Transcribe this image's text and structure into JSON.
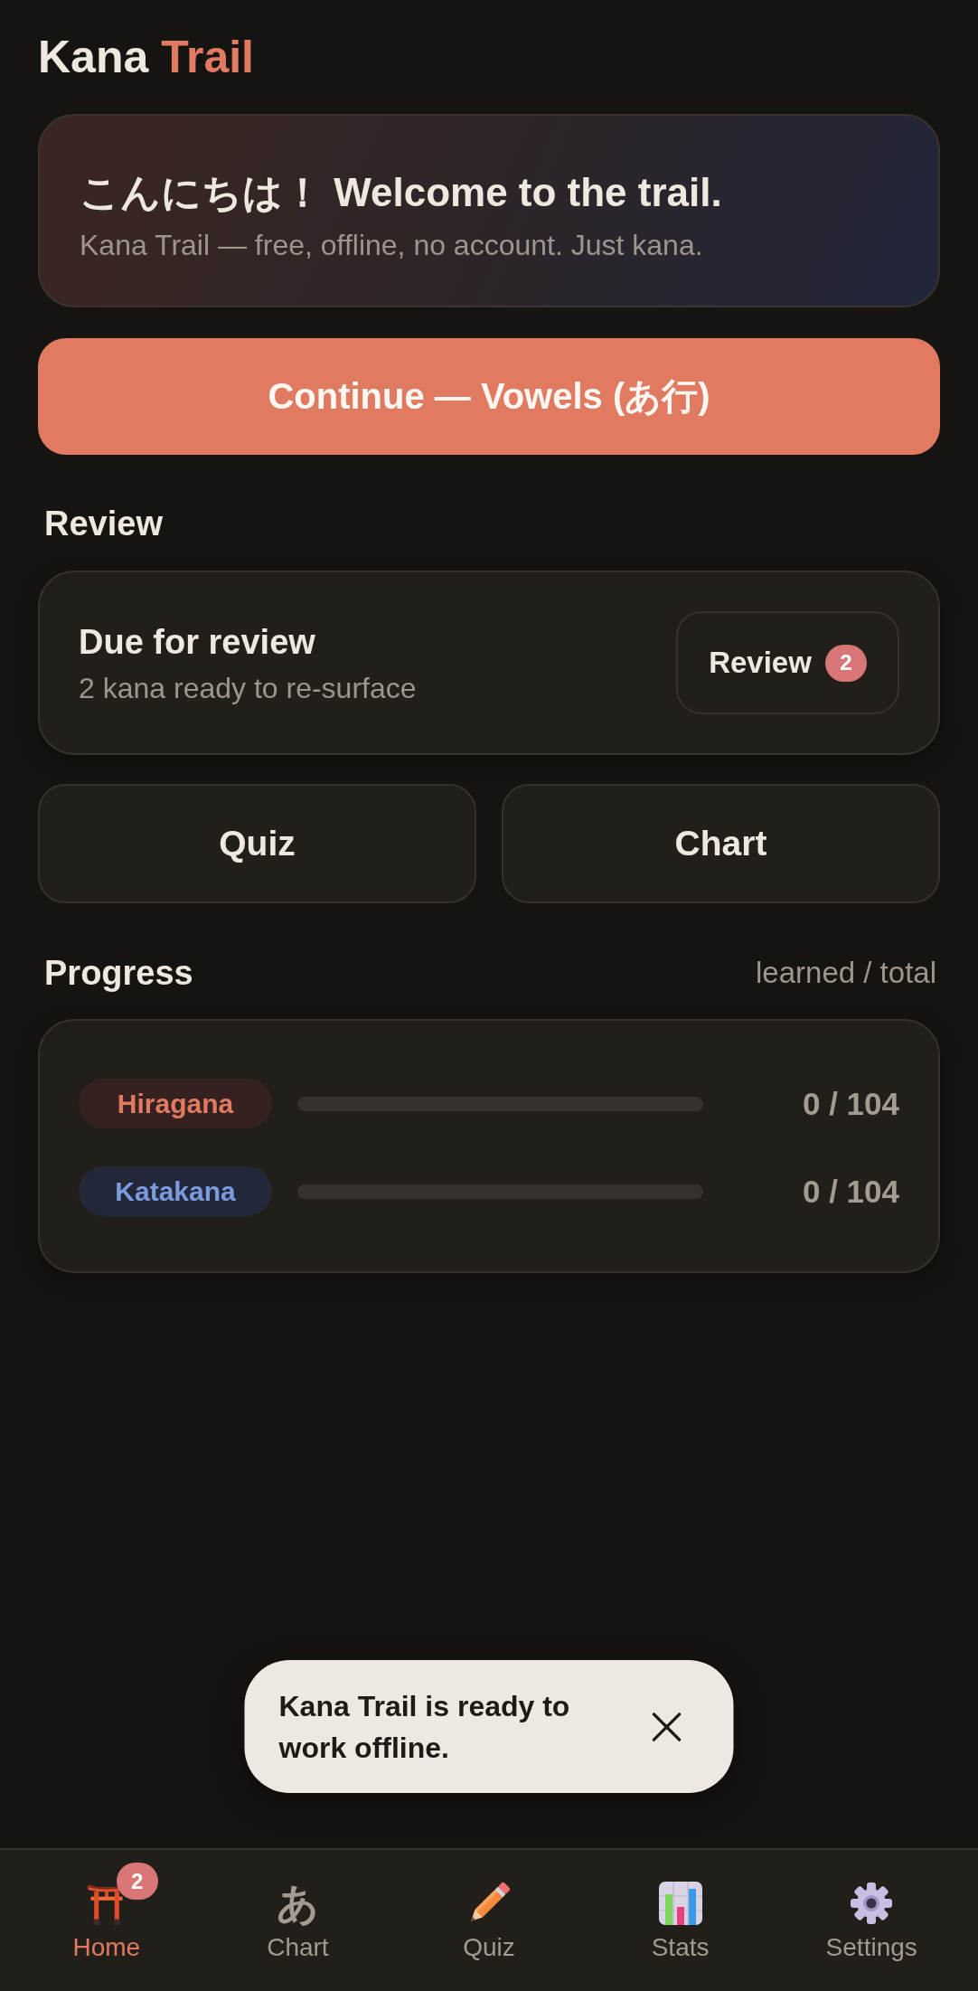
{
  "app_title": {
    "text": "Kana",
    "accent_text": "Trail"
  },
  "welcome": {
    "heading": "こんにちは！ Welcome to the trail.",
    "subtitle": "Kana Trail — free, offline, no account. Just kana."
  },
  "continue_button": {
    "label": "Continue — Vowels (あ行)"
  },
  "review": {
    "heading": "Review",
    "title": "Due for review",
    "subtitle": "2 kana ready to re-surface",
    "button": {
      "label": "Review",
      "badge": "2"
    }
  },
  "shortcuts": [
    {
      "label": "Quiz"
    },
    {
      "label": "Chart"
    }
  ],
  "progress": {
    "heading": "Progress",
    "legend": "learned / total",
    "rows": [
      {
        "name": "Hiragana",
        "color": "#e07a60",
        "level": 0,
        "reading": "0 / 104"
      },
      {
        "name": "Katakana",
        "color": "#7b9ae0",
        "level": 0,
        "reading": "0 / 104"
      }
    ]
  },
  "toast": {
    "message": "Kana Trail is ready to work offline."
  },
  "bottom_nav": {
    "items": [
      {
        "kind": "gate",
        "label": "Home",
        "selected": true,
        "badge": "2"
      },
      {
        "kind": "glyph",
        "glyph": "あ",
        "label": "Chart",
        "selected": false
      },
      {
        "kind": "pencil",
        "label": "Quiz",
        "selected": false
      },
      {
        "kind": "bars",
        "label": "Stats",
        "selected": false
      },
      {
        "kind": "gear",
        "label": "Settings",
        "selected": false
      }
    ]
  }
}
